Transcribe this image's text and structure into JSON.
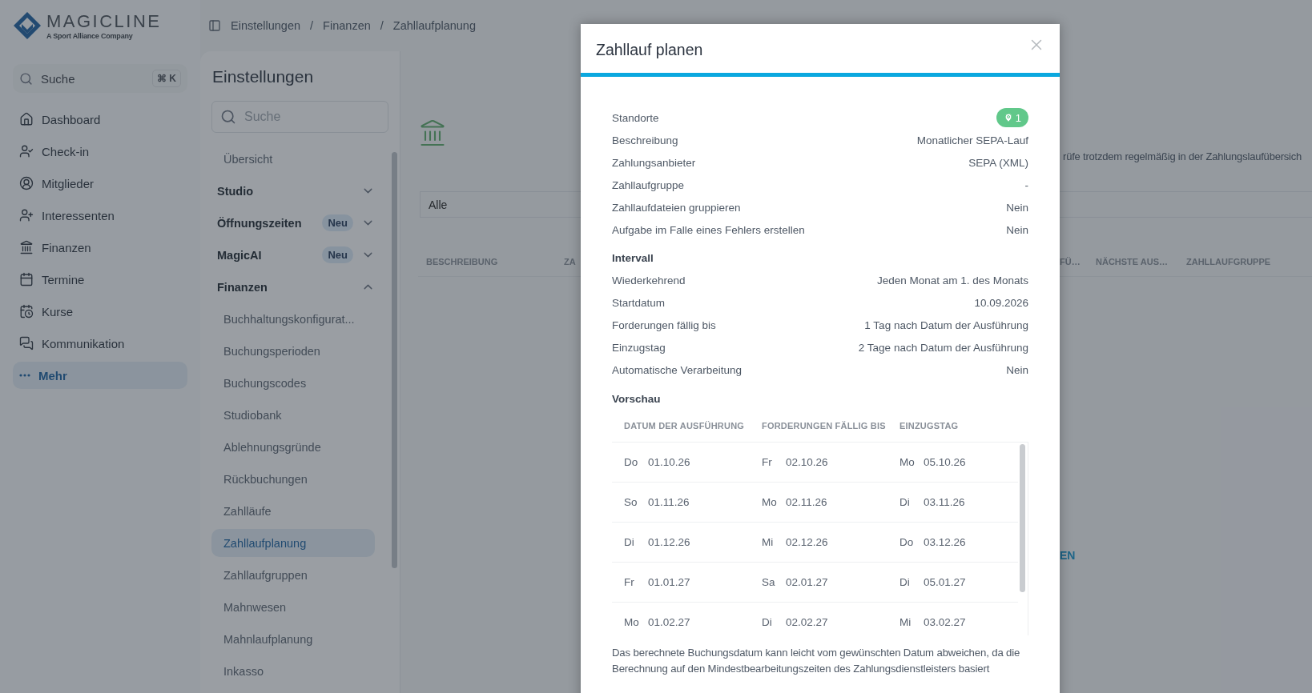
{
  "sidebar": {
    "logo": {
      "name": "MAGICLINE",
      "tagline": "A Sport Alliance Company"
    },
    "search": {
      "placeholder": "Suche",
      "shortcut": "⌘ K"
    },
    "nav": [
      {
        "label": "Dashboard",
        "selected": false
      },
      {
        "label": "Check-in",
        "selected": false
      },
      {
        "label": "Mitglieder",
        "selected": false
      },
      {
        "label": "Interessenten",
        "selected": false
      },
      {
        "label": "Finanzen",
        "selected": false
      },
      {
        "label": "Termine",
        "selected": false
      },
      {
        "label": "Kurse",
        "selected": false
      },
      {
        "label": "Kommunikation",
        "selected": false
      },
      {
        "label": "Mehr",
        "selected": true
      }
    ]
  },
  "breadcrumb": {
    "separator": "/",
    "items": [
      "Einstellungen",
      "Finanzen",
      "Zahllaufplanung"
    ]
  },
  "settings": {
    "title": "Einstellungen",
    "search": {
      "placeholder": "Suche"
    },
    "items": [
      {
        "kind": "link",
        "label": "Übersicht",
        "selected": false
      },
      {
        "kind": "group",
        "label": "Studio",
        "expanded": false
      },
      {
        "kind": "group",
        "label": "Öffnungszeiten",
        "badge": "Neu",
        "expanded": false
      },
      {
        "kind": "group",
        "label": "MagicAI",
        "badge": "Neu",
        "expanded": false
      },
      {
        "kind": "group",
        "label": "Finanzen",
        "expanded": true,
        "children": [
          {
            "label": "Buchhaltungskonfigurat...",
            "selected": false
          },
          {
            "label": "Buchungsperioden",
            "selected": false
          },
          {
            "label": "Buchungscodes",
            "selected": false
          },
          {
            "label": "Studiobank",
            "selected": false
          },
          {
            "label": "Ablehnungsgründe",
            "selected": false
          },
          {
            "label": "Rückbuchungen",
            "selected": false
          },
          {
            "label": "Zahlläufe",
            "selected": false
          },
          {
            "label": "Zahllaufplanung",
            "selected": true
          },
          {
            "label": "Zahllaufgruppen",
            "selected": false
          },
          {
            "label": "Mahnwesen",
            "selected": false
          },
          {
            "label": "Mahnlaufplanung",
            "selected": false
          },
          {
            "label": "Inkasso",
            "selected": false
          }
        ]
      }
    ]
  },
  "main": {
    "info_text": "rüfe trotzdem regelmäßig in der Zahlungslaufübersich",
    "filter": {
      "value": "Alle"
    },
    "table": {
      "columns_left": [
        "BESCHREIBUNG",
        "ZA"
      ],
      "columns_right": [
        "FÜ…",
        "NÄCHSTE AUS…",
        "ZAHLLAUFGRUPPE"
      ]
    },
    "link": "EN"
  },
  "modal": {
    "title": "Zahllauf planen",
    "details": [
      {
        "kind": "badge",
        "label": "Standorte",
        "value": "1"
      },
      {
        "kind": "text",
        "label": "Beschreibung",
        "value": "Monatlicher SEPA-Lauf"
      },
      {
        "kind": "text",
        "label": "Zahlungsanbieter",
        "value": "SEPA (XML)"
      },
      {
        "kind": "text",
        "label": "Zahllaufgruppe",
        "value": "-"
      },
      {
        "kind": "text",
        "label": "Zahllaufdateien gruppieren",
        "value": "Nein"
      },
      {
        "kind": "text",
        "label": "Aufgabe im Falle eines Fehlers erstellen",
        "value": "Nein"
      }
    ],
    "interval": {
      "title": "Intervall",
      "rows": [
        {
          "label": "Wiederkehrend",
          "value": "Jeden Monat am 1. des Monats"
        },
        {
          "label": "Startdatum",
          "value": "10.09.2026"
        },
        {
          "label": "Forderungen fällig bis",
          "value": "1 Tag nach Datum der Ausführung"
        },
        {
          "label": "Einzugstag",
          "value": "2 Tage nach Datum der Ausführung"
        },
        {
          "label": "Automatische Verarbeitung",
          "value": "Nein"
        }
      ]
    },
    "preview": {
      "title": "Vorschau",
      "columns": [
        "DATUM DER AUSFÜHRUNG",
        "FORDERUNGEN FÄLLIG BIS",
        "EINZUGSTAG"
      ],
      "rows": [
        [
          {
            "day": "Do",
            "date": "01.10.26"
          },
          {
            "day": "Fr",
            "date": "02.10.26"
          },
          {
            "day": "Mo",
            "date": "05.10.26"
          }
        ],
        [
          {
            "day": "So",
            "date": "01.11.26"
          },
          {
            "day": "Mo",
            "date": "02.11.26"
          },
          {
            "day": "Di",
            "date": "03.11.26"
          }
        ],
        [
          {
            "day": "Di",
            "date": "01.12.26"
          },
          {
            "day": "Mi",
            "date": "02.12.26"
          },
          {
            "day": "Do",
            "date": "03.12.26"
          }
        ],
        [
          {
            "day": "Fr",
            "date": "01.01.27"
          },
          {
            "day": "Sa",
            "date": "02.01.27"
          },
          {
            "day": "Di",
            "date": "05.01.27"
          }
        ],
        [
          {
            "day": "Mo",
            "date": "01.02.27"
          },
          {
            "day": "Di",
            "date": "02.02.27"
          },
          {
            "day": "Mi",
            "date": "03.02.27"
          }
        ]
      ]
    },
    "note": "Das berechnete Buchungsdatum kann leicht vom gewünschten Datum abweichen, da die Berechnung auf den Mindestbearbeitungszeiten des Zahlungsdienstleisters basiert"
  }
}
